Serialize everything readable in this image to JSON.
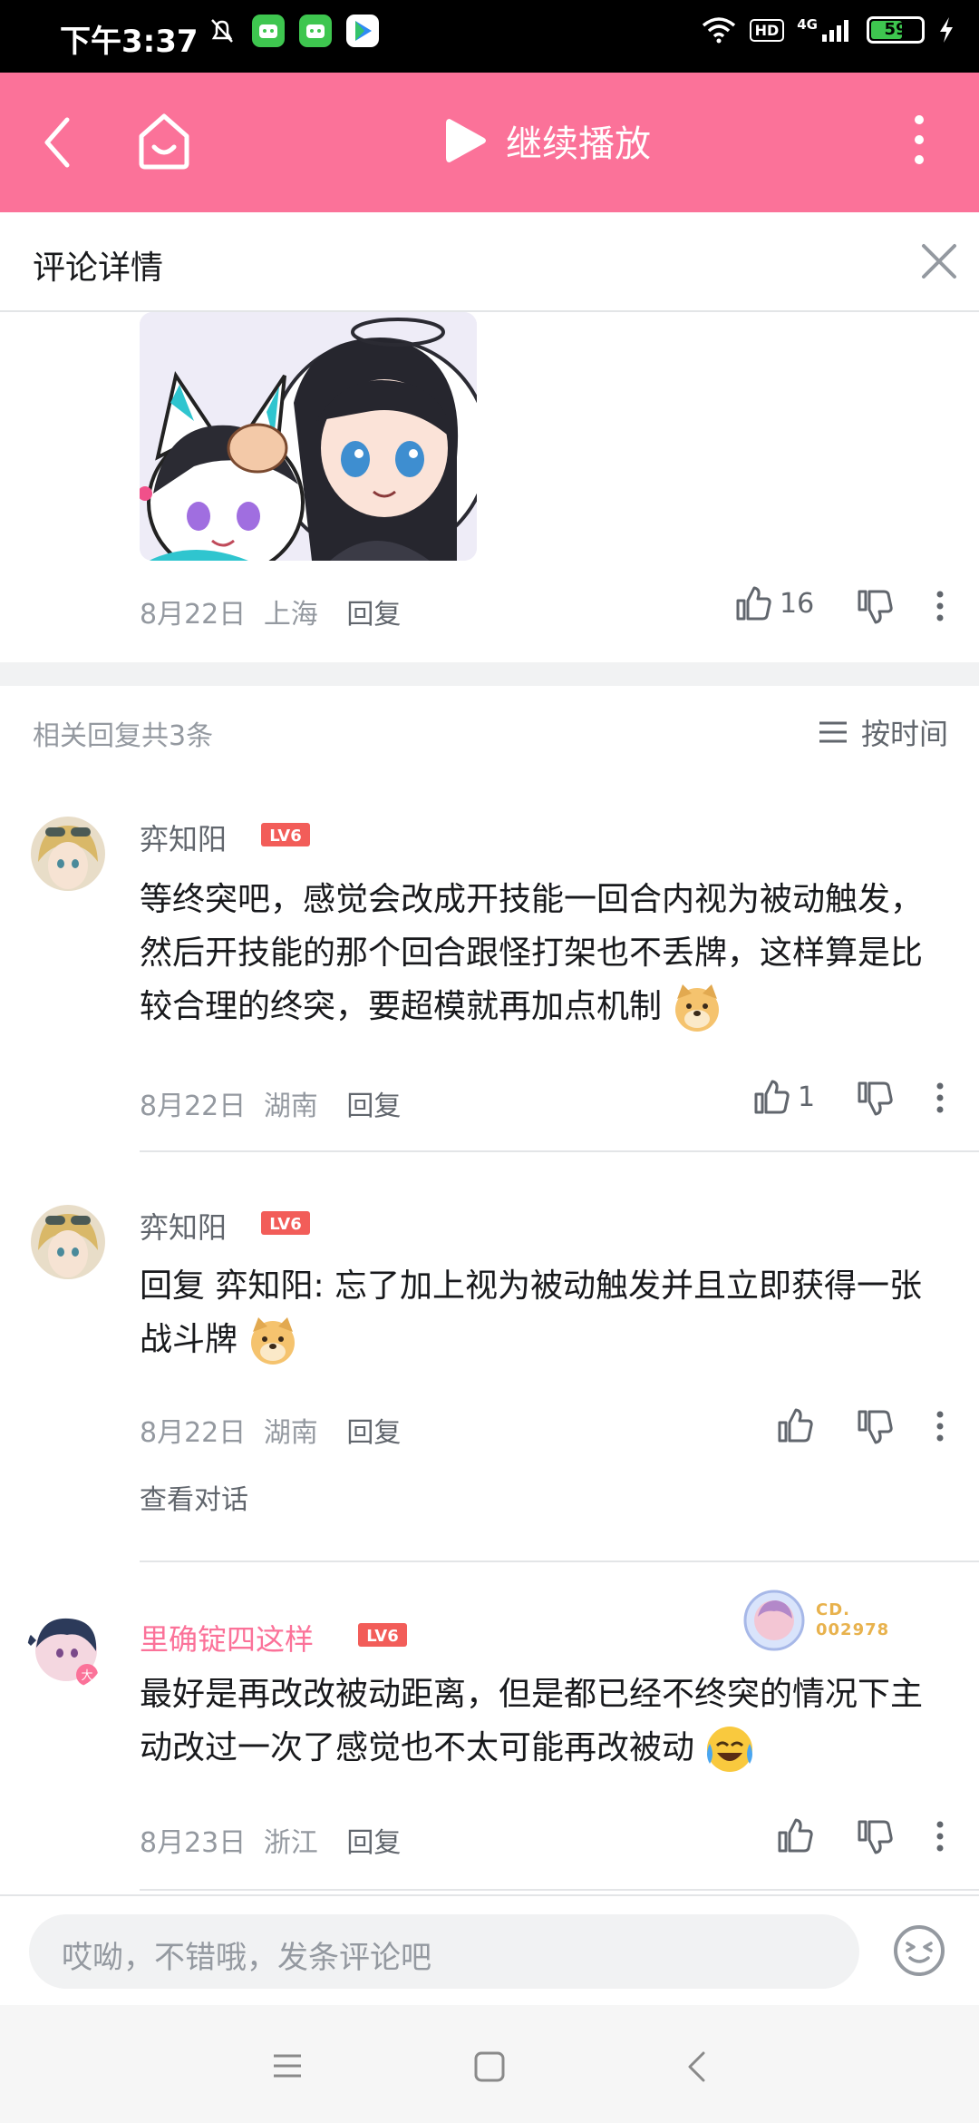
{
  "status_bar": {
    "time": "下午3:37",
    "battery": "59",
    "network": "4G",
    "hd": "HD"
  },
  "top_bar": {
    "continue_label": "继续播放"
  },
  "detail_header": {
    "title": "评论详情"
  },
  "main_comment": {
    "date": "8月22日",
    "location": "上海",
    "reply_label": "回复",
    "like_count": "16"
  },
  "replies_header": {
    "count_label": "相关回复共3条",
    "sort_label": "按时间"
  },
  "replies": [
    {
      "username": "弈知阳",
      "level": "LV6",
      "text": "等终突吧，感觉会改成开技能一回合内视为被动触发，然后开技能的那个回合跟怪打架也不丢牌，这样算是比较合理的终突，要超模就再加点机制",
      "date": "8月22日",
      "location": "湖南",
      "reply_label": "回复",
      "like_count": "1"
    },
    {
      "username": "弈知阳",
      "level": "LV6",
      "reply_prefix": "回复 ",
      "reply_target": "弈知阳: ",
      "text": "忘了加上视为被动触发并且立即获得一张战斗牌",
      "date": "8月22日",
      "location": "湖南",
      "reply_label": "回复",
      "view_conversation": "查看对话"
    },
    {
      "username": "里确锭四这样",
      "level": "LV6",
      "badge_line1": "CD.",
      "badge_line2": "002978",
      "text": "最好是再改改被动距离，但是都已经不终突的情况下主动改过一次了感觉也不太可能再改被动",
      "date": "8月23日",
      "location": "浙江",
      "reply_label": "回复"
    }
  ],
  "comment_input": {
    "placeholder": "哎呦，不错哦，发条评论吧"
  },
  "colors": {
    "accent_pink": "#fb7299",
    "level_red": "#f25d59",
    "text_gray": "#9499a0"
  }
}
